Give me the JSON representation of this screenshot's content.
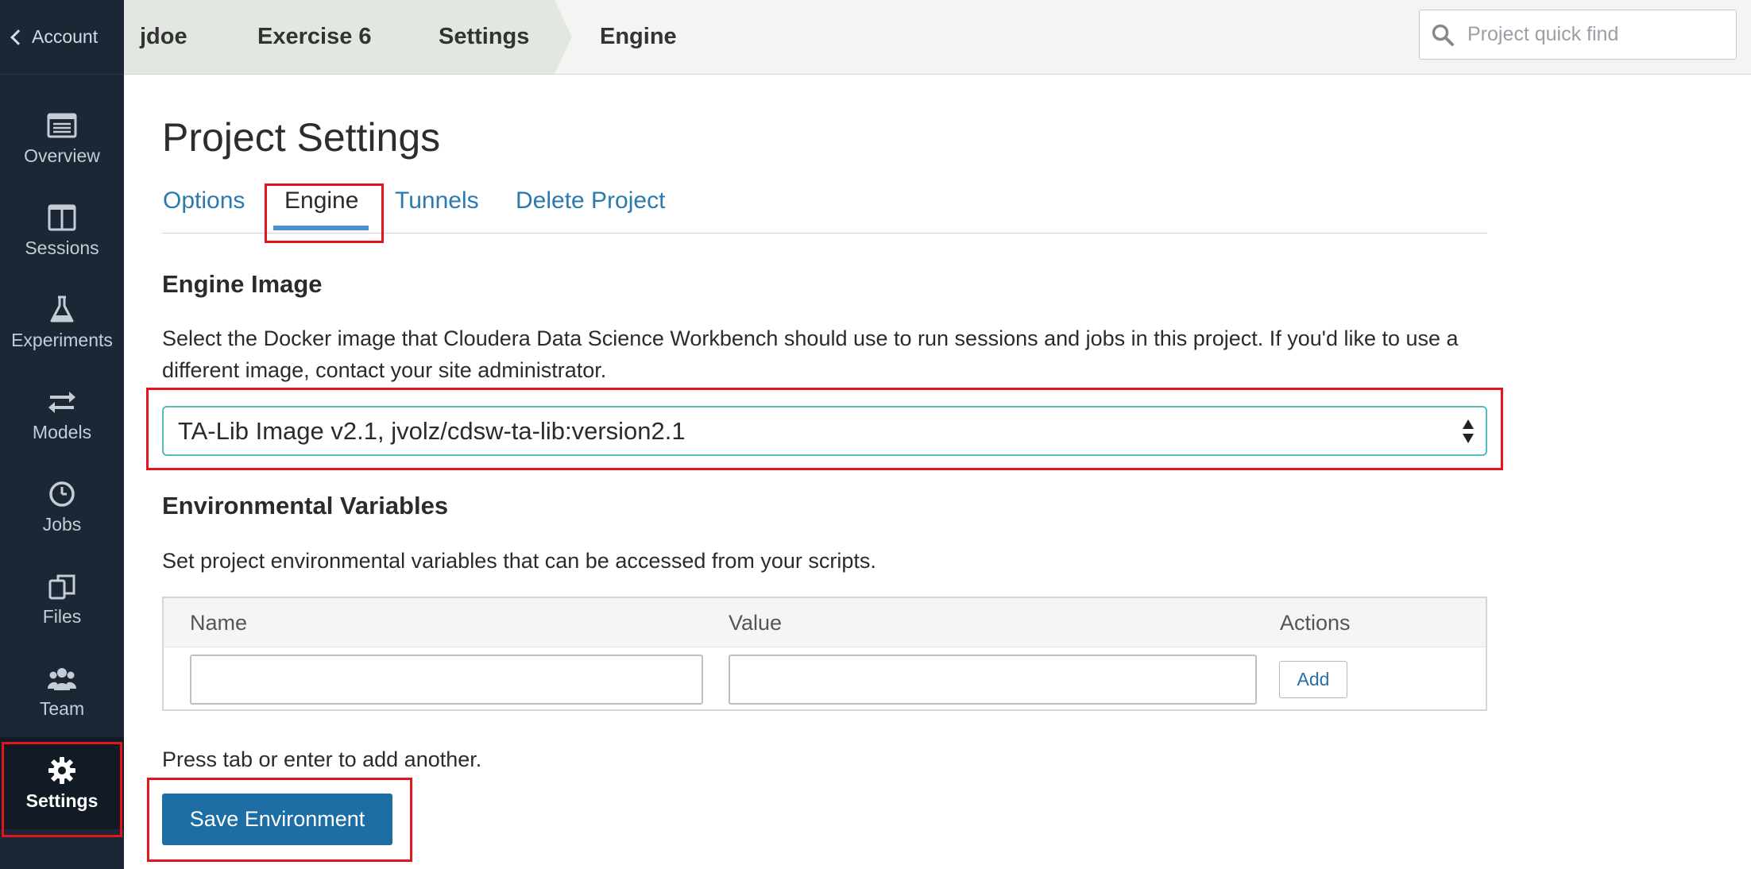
{
  "sidebar": {
    "account_label": "Account",
    "items": [
      {
        "label": "Overview",
        "icon": "overview-list-icon"
      },
      {
        "label": "Sessions",
        "icon": "sessions-panel-icon"
      },
      {
        "label": "Experiments",
        "icon": "flask-icon"
      },
      {
        "label": "Models",
        "icon": "arrows-swap-icon"
      },
      {
        "label": "Jobs",
        "icon": "clock-icon"
      },
      {
        "label": "Files",
        "icon": "files-icon"
      },
      {
        "label": "Team",
        "icon": "team-icon"
      },
      {
        "label": "Settings",
        "icon": "gear-icon"
      }
    ],
    "active_item": "Settings"
  },
  "breadcrumb": {
    "items": [
      "jdoe",
      "Exercise 6",
      "Settings",
      "Engine"
    ]
  },
  "search": {
    "placeholder": "Project quick find"
  },
  "page": {
    "title": "Project Settings",
    "tabs": [
      "Options",
      "Engine",
      "Tunnels",
      "Delete Project"
    ],
    "active_tab": "Engine"
  },
  "engine_image": {
    "heading": "Engine Image",
    "description": "Select the Docker image that Cloudera Data Science Workbench should use to run sessions and jobs in this project. If you'd like to use a different image, contact your site administrator.",
    "selected": "TA-Lib Image v2.1, jvolz/cdsw-ta-lib:version2.1"
  },
  "env_vars": {
    "heading": "Environmental Variables",
    "description": "Set project environmental variables that can be accessed from your scripts.",
    "columns": [
      "Name",
      "Value",
      "Actions"
    ],
    "add_label": "Add",
    "hint": "Press tab or enter to add another.",
    "save_label": "Save Environment"
  },
  "colors": {
    "sidebar_bg": "#1c2736",
    "link": "#2a7ab0",
    "primary_button": "#1c6ea4",
    "highlight_box": "#e3141b",
    "select_border": "#52bcbc"
  }
}
